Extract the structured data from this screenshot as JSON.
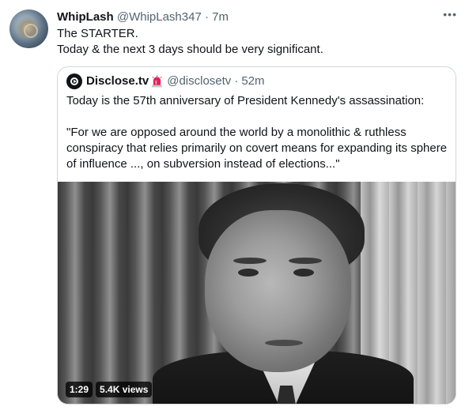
{
  "tweet": {
    "display_name": "WhipLash",
    "handle": "@WhipLash347",
    "separator": "·",
    "time": "7m",
    "lines": [
      "The STARTER.",
      "Today & the next 3 days should be very significant."
    ],
    "more_label": "•••"
  },
  "quote": {
    "display_name": "Disclose.tv",
    "handle": "@disclosetv",
    "separator": "·",
    "time": "52m",
    "paragraph_1": "Today is the 57th anniversary of President Kennedy's assassination:",
    "paragraph_2": "\"For we are opposed around the world by a monolithic & ruthless conspiracy that relies primarily on covert means for expanding its sphere of influence ..., on subversion instead of elections...\"",
    "video": {
      "duration": "1:29",
      "views": "5.4K views"
    }
  },
  "colors": {
    "text": "#0f1419",
    "muted": "#536471",
    "border": "#cfd9de",
    "siren": "#e0245e"
  },
  "icons": {
    "more": "more-dots-icon",
    "quote_avatar": "disclose-logo-icon",
    "siren": "siren-emoji-icon"
  }
}
